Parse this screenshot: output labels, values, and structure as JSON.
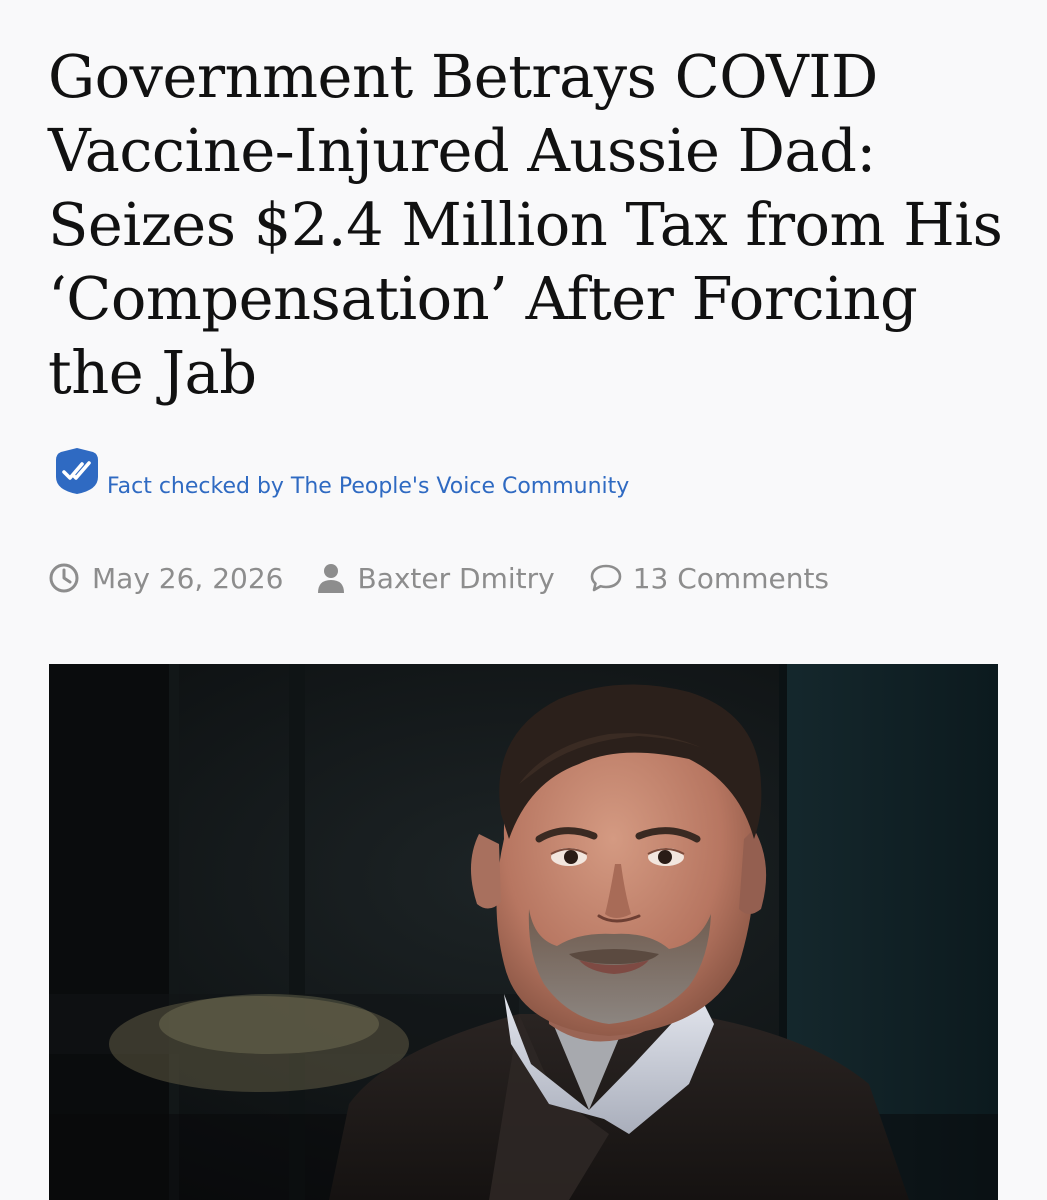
{
  "article": {
    "headline": "Government Betrays COVID Vaccine-Injured Aussie Dad: Seizes $2.4 Million Tax from His ‘Compensation’ After Forcing the Jab",
    "fact_check": {
      "icon": "double-check-badge-icon",
      "label": "Fact checked by The People's Voice Community"
    },
    "meta": {
      "date": "May 26, 2026",
      "author": "Baxter Dmitry",
      "comments": "13 Comments"
    }
  },
  "colors": {
    "headline": "#111111",
    "fact_check_link": "#2f6ac2",
    "badge": "#2f6ac2",
    "meta": "#8d8d8d",
    "background": "#f9f9fa"
  }
}
